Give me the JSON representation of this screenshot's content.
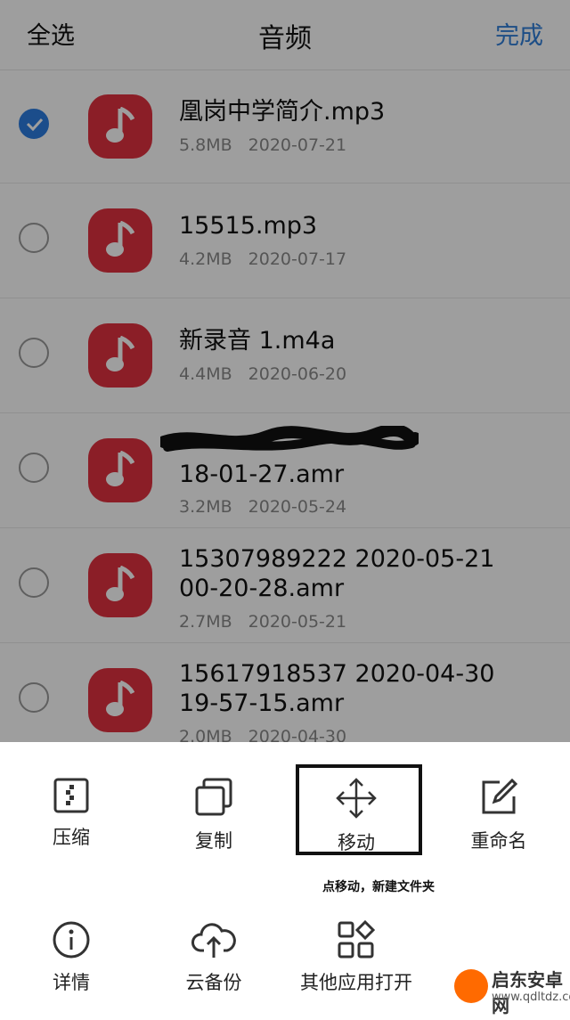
{
  "header": {
    "select_all": "全选",
    "title": "音频",
    "done": "完成"
  },
  "files": [
    {
      "name": "凰岗中学简介.mp3",
      "size": "5.8MB",
      "date": "2020-07-21",
      "checked": true
    },
    {
      "name": "15515.mp3",
      "size": "4.2MB",
      "date": "2020-07-17",
      "checked": false
    },
    {
      "name": "新录音 1.m4a",
      "size": "4.4MB",
      "date": "2020-06-20",
      "checked": false
    },
    {
      "name": "18-01-27.amr",
      "size": "3.2MB",
      "date": "2020-05-24",
      "checked": false
    },
    {
      "name": "15307989222 2020-05-21\n00-20-28.amr",
      "size": "2.7MB",
      "date": "2020-05-21",
      "checked": false
    },
    {
      "name": "15617918537 2020-04-30\n19-57-15.amr",
      "size": "2.0MB",
      "date": "2020-04-30",
      "checked": false
    }
  ],
  "actions": {
    "compress": "压缩",
    "copy": "复制",
    "move": "移动",
    "rename": "重命名",
    "details": "详情",
    "cloud_backup": "云备份",
    "open_with": "其他应用打开"
  },
  "hint": "点移动，新建文件夹",
  "watermark": {
    "name": "启东安卓网",
    "url": "www.qdltdz.com"
  },
  "colors": {
    "accent": "#2f7ed8",
    "file_icon": "#e0313f",
    "checkbox": "#2d7de0"
  }
}
